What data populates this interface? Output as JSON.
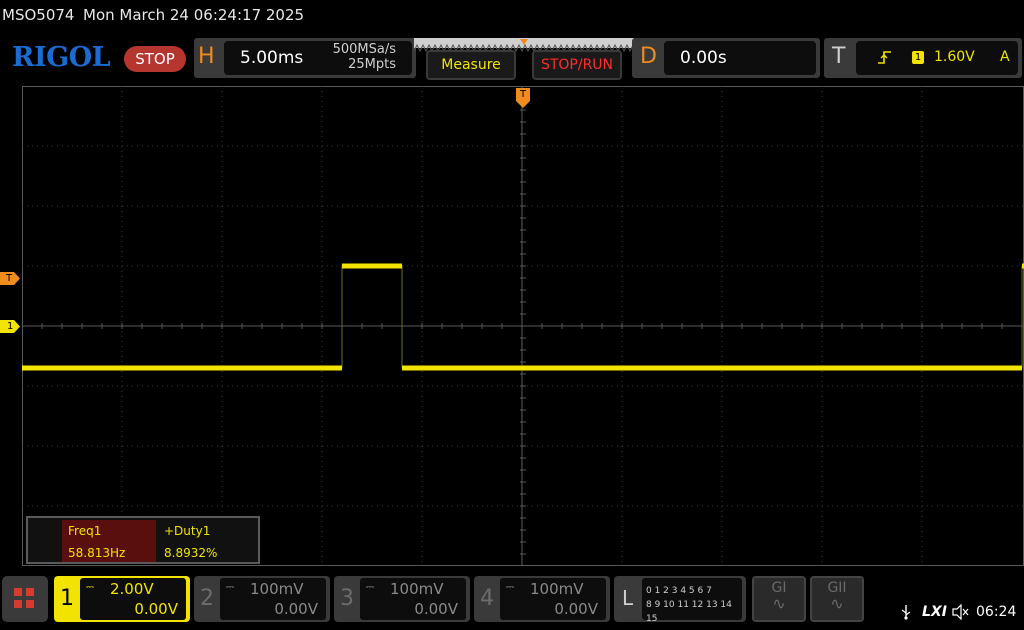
{
  "title_bar": {
    "model": "MSO5074",
    "datetime": "Mon March 24 06:24:17 2025"
  },
  "brand": {
    "logo": "RIGOL",
    "run_state": "STOP"
  },
  "horizontal": {
    "letter": "H",
    "timebase": "5.00ms",
    "sample_rate": "500MSa/s",
    "memory_depth": "25Mpts"
  },
  "buttons": {
    "measure": "Measure",
    "stop_run": "STOP/RUN"
  },
  "delay": {
    "letter": "D",
    "value": "0.00s"
  },
  "trigger": {
    "letter": "T",
    "edge_icon": "rising-edge-icon",
    "source": "1",
    "level": "1.60V",
    "mode": "A"
  },
  "markers": {
    "channel1": "1",
    "trigger_level": "T",
    "trigger_position": "T"
  },
  "waveform": {
    "color": "#f2e400",
    "low_level_div": -0.7,
    "high_level_div": 1.0,
    "period_div": 6.8,
    "pulse_width_div": 0.6,
    "first_rise_div": 3.2
  },
  "measurements": [
    {
      "name": "Freq1",
      "value": "58.813Hz"
    },
    {
      "name": "+Duty1",
      "value": "8.8932%"
    }
  ],
  "channels": [
    {
      "num": "1",
      "scale": "2.00V",
      "offset": "0.00V",
      "active": true
    },
    {
      "num": "2",
      "scale": "100mV",
      "offset": "0.00V",
      "active": false
    },
    {
      "num": "3",
      "scale": "100mV",
      "offset": "0.00V",
      "active": false
    },
    {
      "num": "4",
      "scale": "100mV",
      "offset": "0.00V",
      "active": false
    }
  ],
  "logic": {
    "letter": "L",
    "row1": "0 1 2 3  4 5 6 7",
    "row2": "8 9 10 11 12 13 14 15"
  },
  "generators": [
    {
      "label": "GI"
    },
    {
      "label": "GII"
    }
  ],
  "status_bar": {
    "lxi": "LXI",
    "time": "06:24"
  },
  "colors": {
    "ch1": "#f2e400",
    "trigger": "#f08b1e",
    "stop": "#b5362e",
    "logo": "#1a6cd1"
  }
}
